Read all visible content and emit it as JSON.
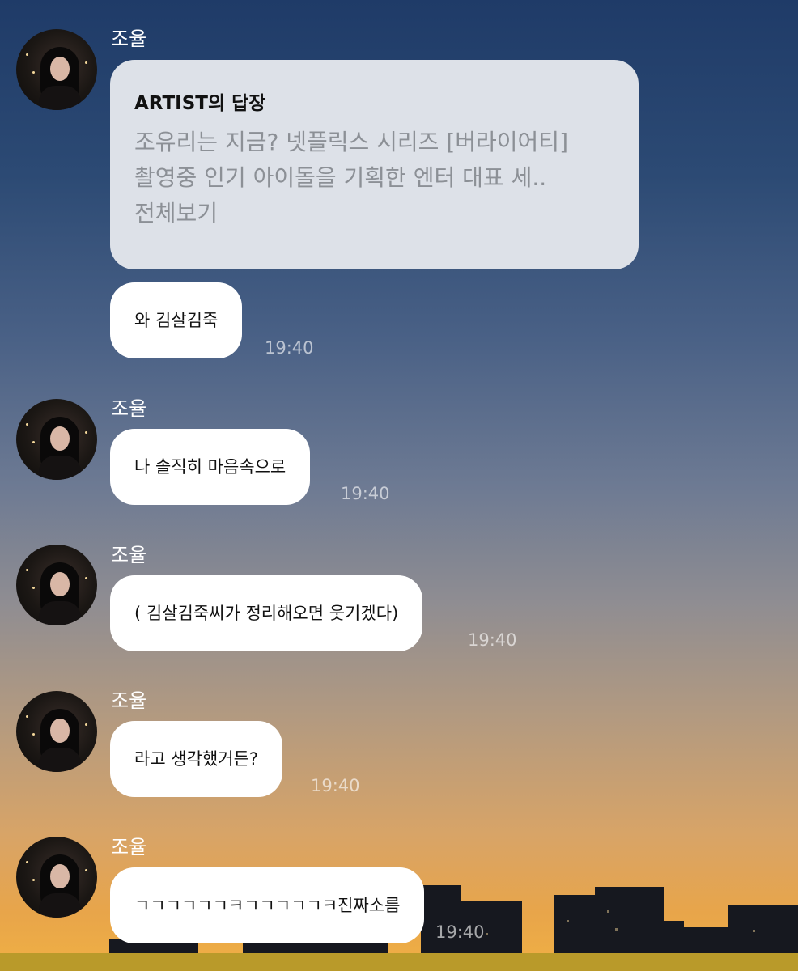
{
  "sender_name": "조율",
  "reply": {
    "title": "ARTIST의 답장",
    "line1": "조유리는 지금? 넷플릭스 시리즈 [버라이어티]",
    "line2": "촬영중 인기 아이돌을 기획한 엔터 대표 세..",
    "more": "전체보기"
  },
  "messages": [
    {
      "text": "와 김살김죽",
      "time": "19:40"
    },
    {
      "text": "나 솔직히 마음속으로",
      "time": "19:40"
    },
    {
      "text": "( 김살김죽씨가 정리해오면 웃기겠다)",
      "time": "19:40"
    },
    {
      "text": "라고 생각했거든?",
      "time": "19:40"
    },
    {
      "text": "ㄱㄱㄱㄱㄱㄱㅋㄱㄱㄱㄱㄱㅋ진짜소름",
      "time": "19:40"
    }
  ]
}
